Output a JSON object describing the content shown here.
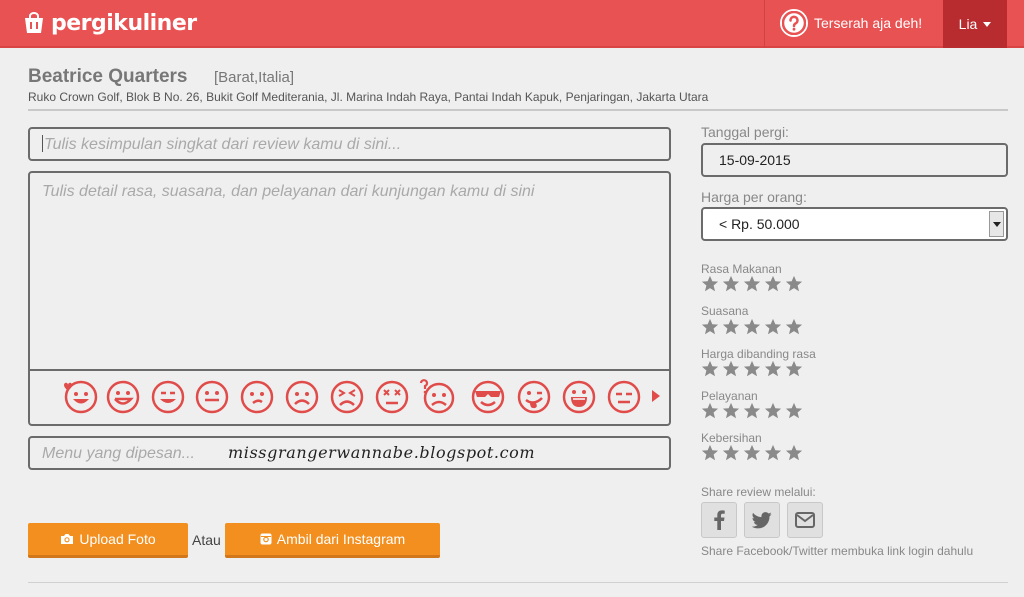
{
  "header": {
    "logo_text": "pergikuliner",
    "help_label": "Terserah aja deh!",
    "user_name": "Lia",
    "colors": {
      "brand": "#e95253",
      "user_bg": "#b82b2e"
    }
  },
  "place": {
    "name": "Beatrice Quarters",
    "category": "[Barat,Italia]",
    "address": "Ruko Crown Golf, Blok B No. 26, Bukit Golf Mediterania, Jl. Marina Indah Raya, Pantai Indah Kapuk, Penjaringan, Jakarta Utara"
  },
  "review": {
    "summary_placeholder": "Tulis kesimpulan singkat dari review kamu di sini...",
    "detail_placeholder": "Tulis detail rasa, suasana, dan pelayanan dari kunjungan kamu di sini",
    "menu_placeholder": "Menu yang dipesan...",
    "watermark": "missgrangerwannabe.blogspot.com",
    "emojis": [
      "love-emoji-icon",
      "smile-emoji-icon",
      "grin-emoji-icon",
      "happy-emoji-icon",
      "meh-emoji-icon",
      "sad-emoji-icon",
      "crying-emoji-icon",
      "dizzy-emoji-icon",
      "confused-emoji-icon",
      "cool-emoji-icon",
      "tongue-emoji-icon",
      "laugh-emoji-icon",
      "neutral-emoji-icon"
    ]
  },
  "actions": {
    "upload_label": "Upload Foto",
    "or_label": "Atau",
    "instagram_label": "Ambil dari Instagram",
    "accent": "#f28f1e"
  },
  "sidebar": {
    "date_label": "Tanggal pergi:",
    "date_value": "15-09-2015",
    "price_label": "Harga per orang:",
    "price_value": "< Rp. 50.000",
    "ratings": [
      {
        "label": "Rasa Makanan",
        "value": 0
      },
      {
        "label": "Suasana",
        "value": 0
      },
      {
        "label": "Harga dibanding rasa",
        "value": 0
      },
      {
        "label": "Pelayanan",
        "value": 0
      },
      {
        "label": "Kebersihan",
        "value": 0
      }
    ],
    "share_label": "Share review melalui:",
    "share_icons": [
      "facebook-icon",
      "twitter-icon",
      "email-icon"
    ],
    "share_note": "Share Facebook/Twitter membuka link login dahulu"
  }
}
